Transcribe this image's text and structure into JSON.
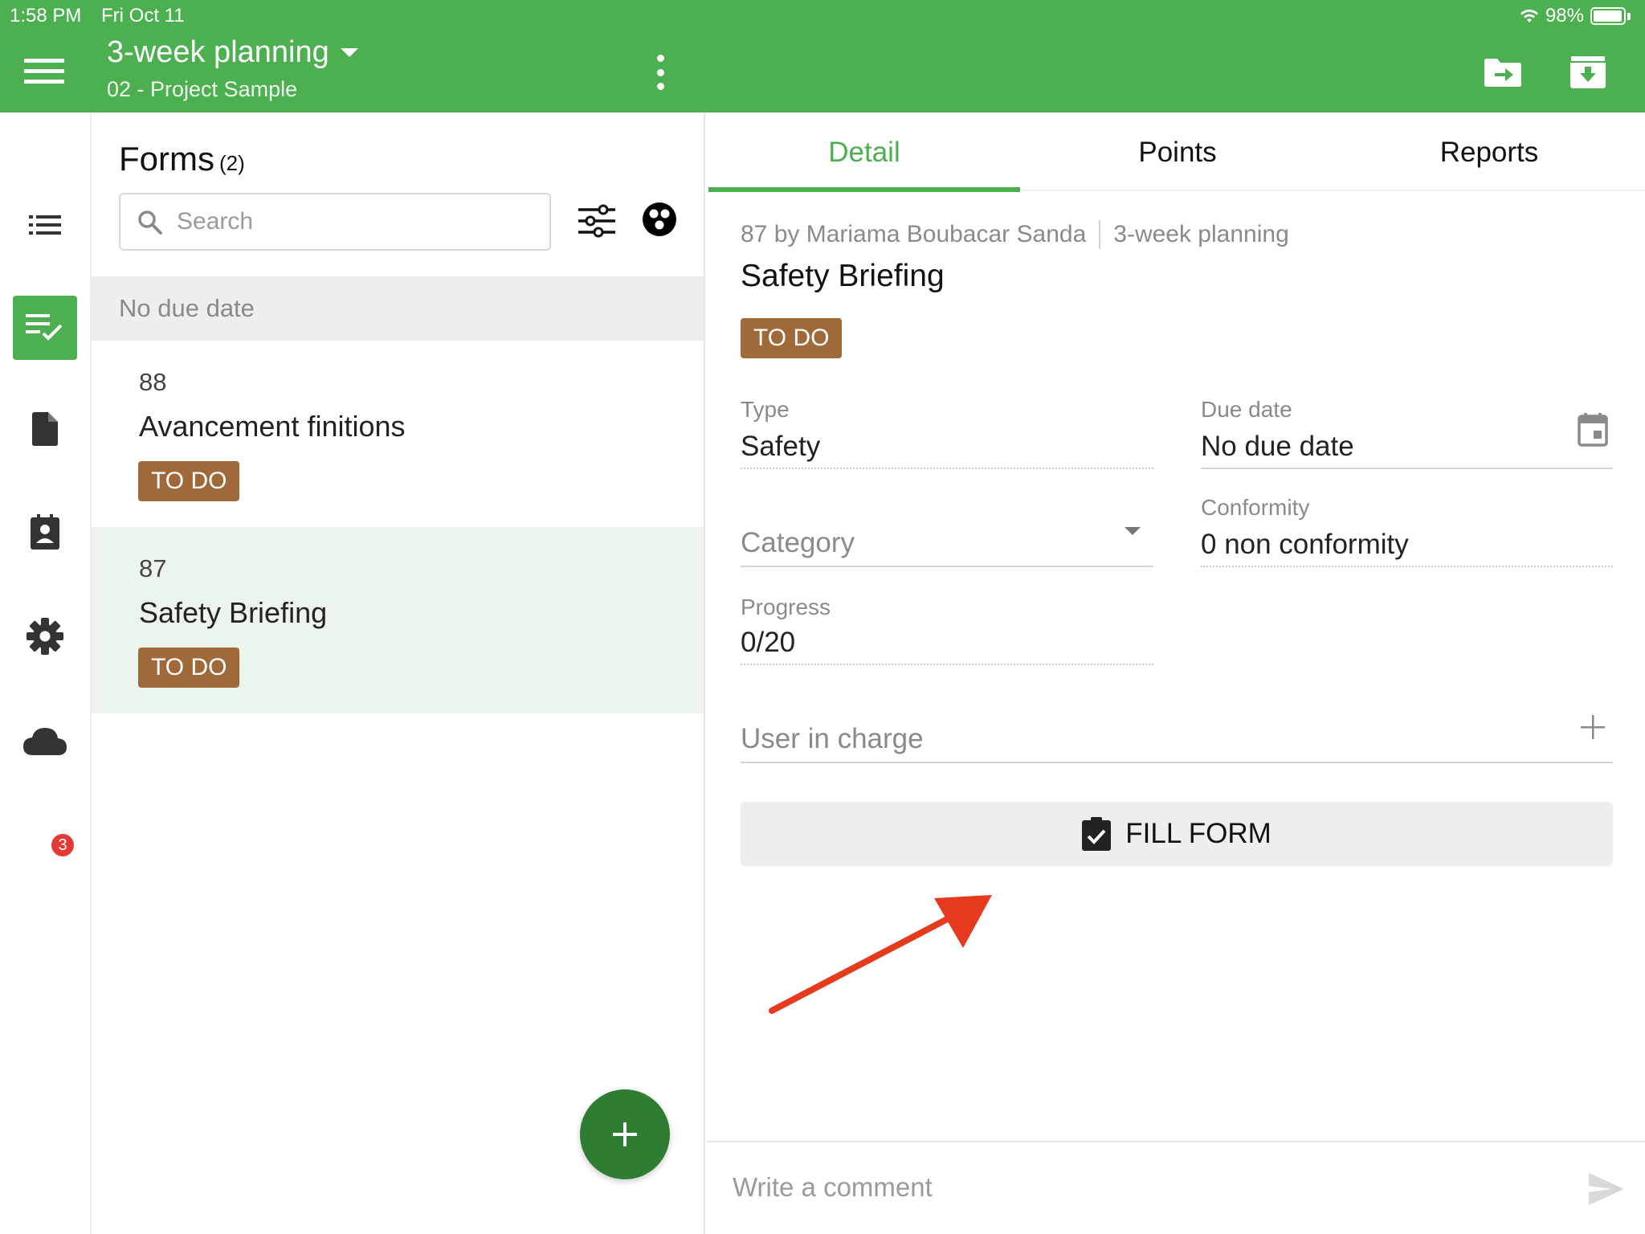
{
  "status_bar": {
    "time": "1:58 PM",
    "date": "Fri Oct 11",
    "battery": "98%"
  },
  "header": {
    "title": "3-week planning",
    "subtitle": "02 - Project Sample",
    "bg_color": "#4caf50",
    "icons": [
      "menu-icon",
      "caret-down-icon",
      "more-vert-icon",
      "folder-move-icon",
      "archive-download-icon"
    ]
  },
  "sidebar": {
    "items": [
      {
        "name": "list-icon",
        "active": false
      },
      {
        "name": "form-check-icon",
        "active": true
      },
      {
        "name": "document-icon",
        "active": false
      },
      {
        "name": "contact-card-icon",
        "active": false
      },
      {
        "name": "gear-icon",
        "active": false
      },
      {
        "name": "cloud-sync-icon",
        "active": false
      }
    ],
    "sync_badge": "3"
  },
  "forms_list": {
    "title": "Forms",
    "count": "(2)",
    "search_placeholder": "Search",
    "section": "No due date",
    "items": [
      {
        "number": "88",
        "title": "Avancement finitions",
        "status": "TO DO"
      },
      {
        "number": "87",
        "title": "Safety Briefing",
        "status": "TO DO"
      }
    ],
    "add_label": "+"
  },
  "detail": {
    "tabs": [
      {
        "label": "Detail"
      },
      {
        "label": "Points"
      },
      {
        "label": "Reports"
      }
    ],
    "meta_author": "87 by Mariama Boubacar Sanda",
    "meta_plan": "3-week planning",
    "title": "Safety Briefing",
    "status": "TO DO",
    "type_label": "Type",
    "type_value": "Safety",
    "due_label": "Due date",
    "due_value": "No due date",
    "category_placeholder": "Category",
    "conformity_label": "Conformity",
    "conformity_value": "0 non conformity",
    "progress_label": "Progress",
    "progress_value": "0/20",
    "user_placeholder": "User in charge",
    "fill_form_label": "FILL FORM",
    "comment_placeholder": "Write a comment"
  },
  "colors": {
    "primary": "#4caf50",
    "primary_dark": "#2e7d32",
    "status_todo": "#a0693a",
    "selected_row": "#ecf5ec",
    "annotation": "#e53a1e"
  }
}
